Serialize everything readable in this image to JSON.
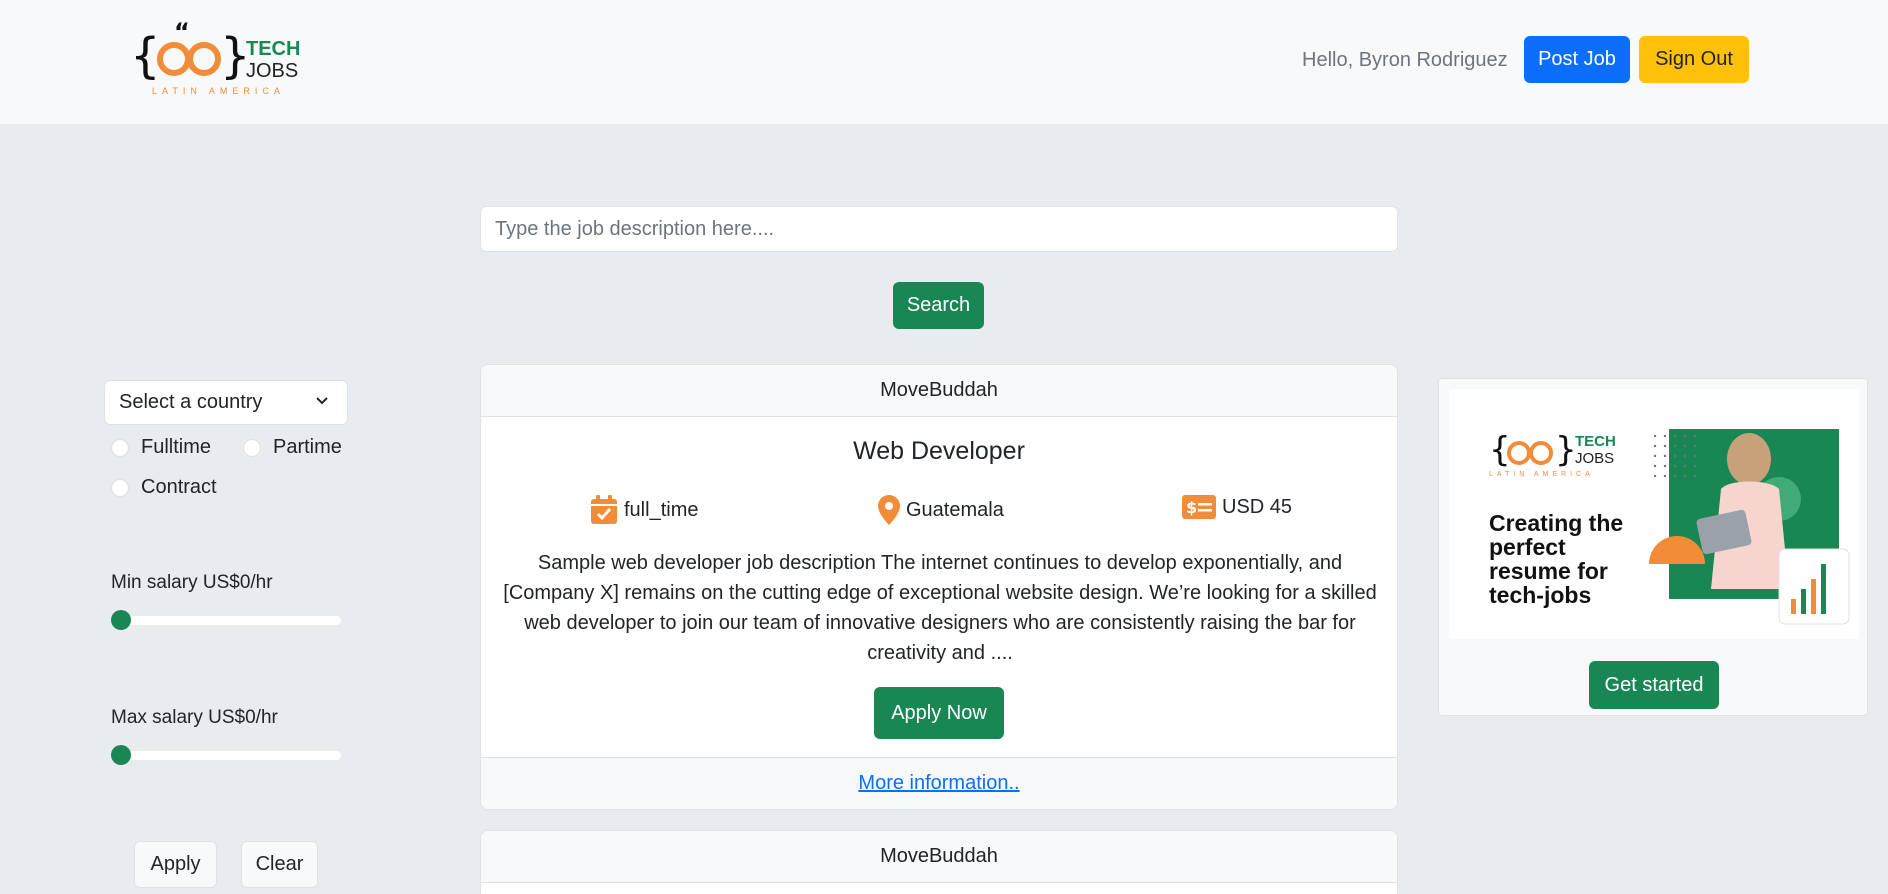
{
  "header": {
    "logo": {
      "word1": "TECH",
      "word2": "JOBS",
      "tagline": "LATIN AMERICA"
    },
    "greeting": "Hello, Byron Rodriguez",
    "post_job_label": "Post Job",
    "sign_out_label": "Sign Out"
  },
  "search": {
    "placeholder": "Type the job description here....",
    "button_label": "Search"
  },
  "filters": {
    "country_select": "Select a country",
    "job_types": [
      "Fulltime",
      "Partime",
      "Contract"
    ],
    "min_salary_label": "Min salary US$0/hr",
    "min_salary_value": 0,
    "max_salary_label": "Max salary US$0/hr",
    "max_salary_value": 0,
    "apply_label": "Apply",
    "clear_label": "Clear"
  },
  "jobs": [
    {
      "company": "MoveBuddah",
      "title": "Web Developer",
      "type": "full_time",
      "location": "Guatemala",
      "salary": "USD 45",
      "description": "Sample web developer job description The internet continues to develop exponentially, and [Company X] remains on the cutting edge of exceptional website design. We’re looking for a skilled web developer to join our team of innovative designers who are consistently raising the bar for creativity and ....",
      "apply_label": "Apply Now",
      "more_info_label": "More information.."
    },
    {
      "company": "MoveBuddah"
    }
  ],
  "ad": {
    "logo_word1": "TECH",
    "logo_word2": "JOBS",
    "logo_tagline": "LATIN AMERICA",
    "headline": "Creating the perfect resume for tech-jobs",
    "button_label": "Get started"
  },
  "colors": {
    "primary": "#0d6efd",
    "success": "#198754",
    "warning": "#ffc107",
    "accent_orange": "#f28c38"
  },
  "icons": {
    "job_type": "calendar-check-icon",
    "location": "map-pin-icon",
    "salary": "money-card-icon",
    "select": "chevron-down-icon"
  }
}
